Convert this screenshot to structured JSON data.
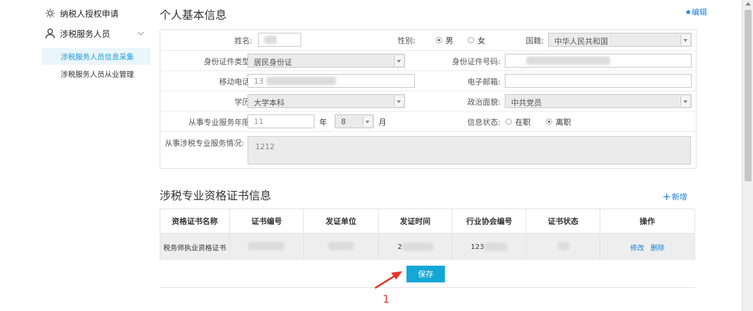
{
  "sidebar": {
    "items": [
      {
        "label": "纳税人授权申请",
        "icon": "gear-icon"
      },
      {
        "label": "涉税服务人员",
        "icon": "user-icon"
      }
    ],
    "subitems": [
      {
        "label": "涉税服务人员信息采集",
        "active": true
      },
      {
        "label": "涉税服务人员从业管理",
        "active": false
      }
    ]
  },
  "personal": {
    "title": "个人基本信息",
    "edit_label": "★编辑",
    "name_label": "姓名:",
    "gender_label": "性别:",
    "gender_male": "男",
    "gender_female": "女",
    "nationality_label": "国籍:",
    "nationality_value": "中华人民共和国",
    "idtype_label": "身份证件类型:",
    "idtype_value": "居民身份证",
    "idno_label": "身份证件号码:",
    "mobile_label": "移动电话:",
    "mobile_value": "13",
    "email_label": "电子邮箱:",
    "edu_label": "学历:",
    "edu_value": "大学本科",
    "political_label": "政治面貌:",
    "political_value": "中共党员",
    "years_label": "从事专业服务年限:",
    "years_value": "11",
    "year_unit": "年",
    "months_value": "8",
    "month_unit": "月",
    "status_label": "信息状态:",
    "status_on": "在职",
    "status_off": "离职",
    "desc_label": "从事涉税专业服务情况:",
    "desc_value": "1212"
  },
  "certs": {
    "title": "涉税专业资格证书信息",
    "add_label": "新增",
    "columns": [
      "资格证书名称",
      "证书编号",
      "发证单位",
      "发证时间",
      "行业协会编号",
      "证书状态",
      "操作"
    ],
    "rows": [
      {
        "name": "税务师执业资格证书",
        "issue_date": "2",
        "assoc_no": "123",
        "ops": [
          "修改",
          "删除"
        ]
      }
    ]
  },
  "save_label": "保存",
  "annotation_number": "1",
  "colors": {
    "accent": "#14a7d5",
    "link": "#1a7fd6",
    "annotation": "#e83428"
  }
}
